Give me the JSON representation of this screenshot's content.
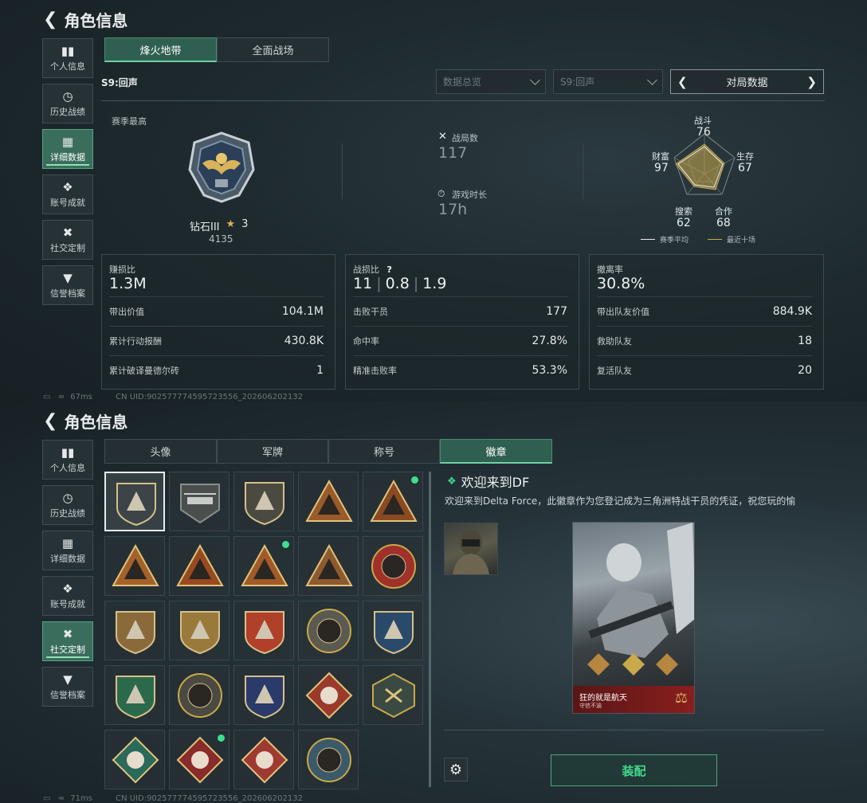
{
  "top": {
    "title": "角色信息",
    "nav": [
      "个人信息",
      "历史战绩",
      "详细数据",
      "账号成就",
      "社交定制",
      "信誉档案"
    ],
    "active_nav": 2,
    "tabs": [
      "烽火地带",
      "全面战场"
    ],
    "season": "S9:回声",
    "select_overview": "数据总览",
    "select_season": "S9:回声",
    "match_data": "对局数据",
    "season_best_label": "赛季最高",
    "rank_name": "钻石III",
    "rank_stars": "3",
    "rank_points": "4135",
    "battles_label": "战局数",
    "battles_value": "117",
    "playtime_label": "游戏时长",
    "playtime_value": "17h",
    "radar": {
      "labels": {
        "combat": "战斗",
        "survival": "生存",
        "cooperation": "合作",
        "search": "搜索",
        "wealth": "财富"
      },
      "values": {
        "combat": "76",
        "survival": "67",
        "cooperation": "68",
        "search": "62",
        "wealth": "97"
      },
      "legend_avg": "赛季平均",
      "legend_recent": "最近十场",
      "colors": {
        "avg": "#e8ecee",
        "recent": "#c9a94a"
      }
    },
    "card1": {
      "label": "赚损比",
      "value": "1.3M",
      "rows": [
        [
          "带出价值",
          "104.1M"
        ],
        [
          "累计行动报酬",
          "430.8K"
        ],
        [
          "累计破译曼德尔砖",
          "1"
        ]
      ]
    },
    "card2": {
      "label": "战损比",
      "help": "?",
      "v1": "11",
      "v2": "0.8",
      "v3": "1.9",
      "rows": [
        [
          "击败干员",
          "177"
        ],
        [
          "命中率",
          "27.8%"
        ],
        [
          "精准击败率",
          "53.3%"
        ]
      ]
    },
    "card3": {
      "label": "撤离率",
      "value": "30.8%",
      "rows": [
        [
          "带出队友价值",
          "884.9K"
        ],
        [
          "救助队友",
          "18"
        ],
        [
          "复活队友",
          "20"
        ]
      ]
    },
    "ping": "67ms",
    "uid": "CN UID:9025777745957235​56_202606202132"
  },
  "bottom": {
    "title": "角色信息",
    "nav": [
      "个人信息",
      "历史战绩",
      "详细数据",
      "账号成就",
      "社交定制",
      "信誉档案"
    ],
    "active_nav": 4,
    "tabs": [
      "头像",
      "军牌",
      "称号",
      "徽章"
    ],
    "active_tab": 3,
    "badge_names": [
      "default-triangle-badge",
      "helicopter-badge",
      "dagger-shield-badge",
      "s4-badge",
      "s8-badge",
      "pyramid-badge",
      "number-one-badge",
      "usb-triangle-badge",
      "soldiers-triangle-badge",
      "star-emblem-badge",
      "shield-fist-badge",
      "wing-shield-badge",
      "gear-shield-badge",
      "mask-badge",
      "rifle-shield-badge",
      "crosshair-green-badge",
      "knife-circle-badge",
      "ammo-shield-badge",
      "wolf-diamond-badge",
      "wasp-hexagon-badge",
      "medic-diamond-badge",
      "dragon-diamond-badge",
      "runner-diamond-badge",
      "wolf-circle-badge"
    ],
    "badge_new": [
      4,
      7,
      21
    ],
    "detail_title": "欢迎来到DF",
    "detail_desc": "欢迎来到Delta Force，此徽章作为您登记成为三角洲特战干员的凭证，祝您玩的愉",
    "card_name": "狂的就是航天",
    "card_sub": "守信不渝",
    "equip": "装配",
    "ping": "71ms",
    "uid": "CN UID:902577774595723556_202606202132"
  }
}
